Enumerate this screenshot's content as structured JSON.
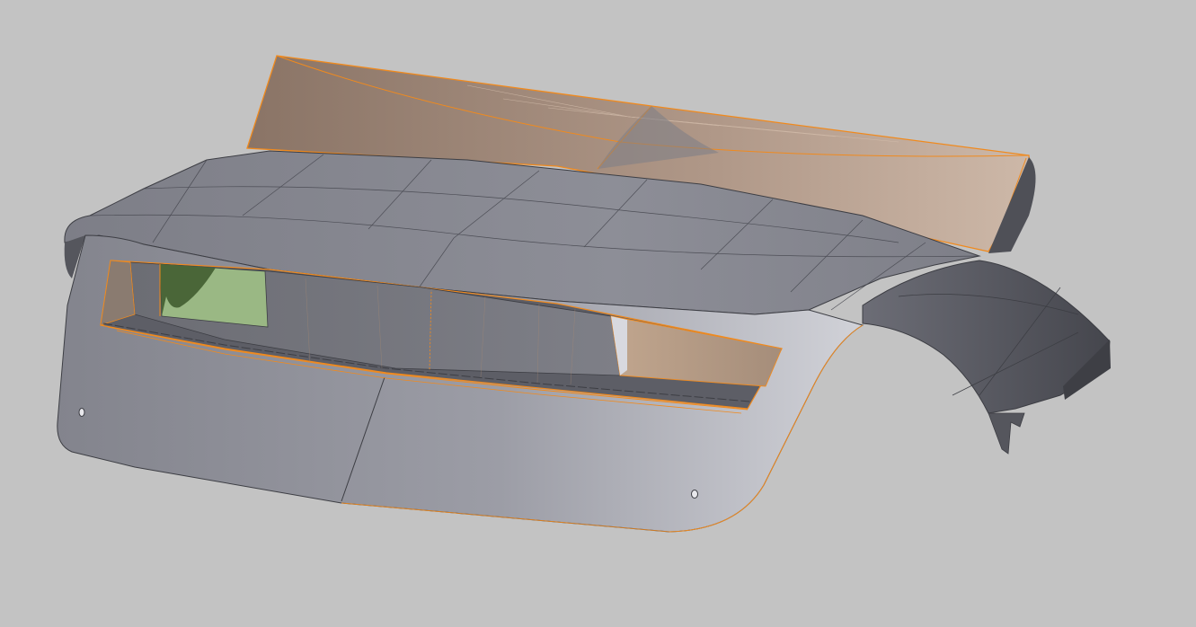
{
  "viewport": {
    "background_color": "#c3c3c3"
  },
  "model": {
    "part_kind": "instrument-panel-shroud",
    "body_color": "#8f9099",
    "body_shadow_color": "#4b4c53",
    "selection_color": "#f08a1e",
    "rear_surface_color": "#a08a7a",
    "interior_color": "#7d7e86",
    "display_tint_color": "#9ab884",
    "display_dark_color": "#4a6638"
  }
}
